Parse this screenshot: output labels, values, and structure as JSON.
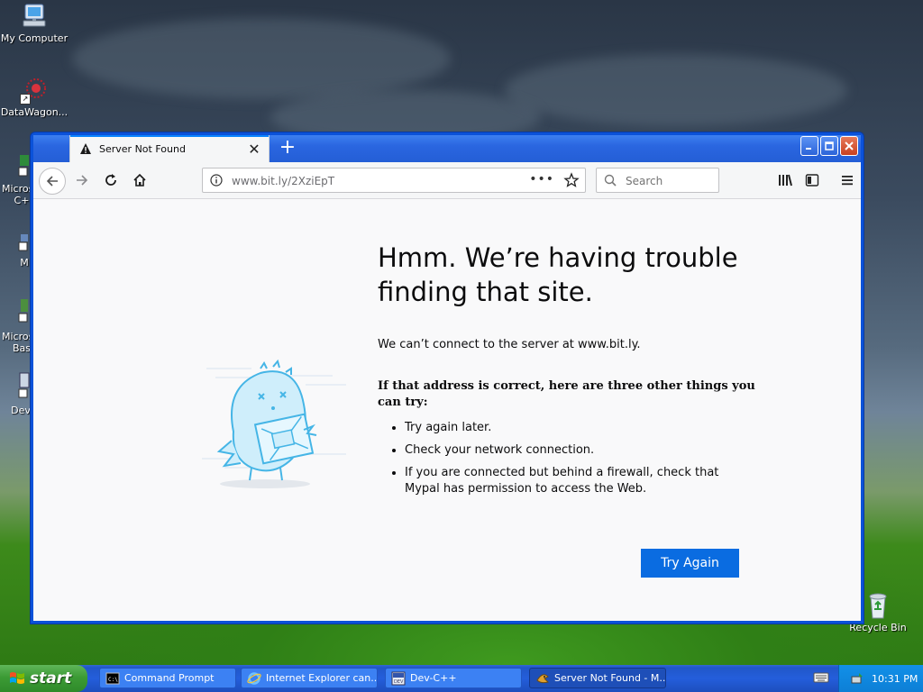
{
  "desktop": {
    "icons": [
      {
        "label": "My Computer"
      },
      {
        "label": "DataWagon..."
      },
      {
        "label": "Recycle Bin"
      }
    ],
    "partial_labels": [
      "Micros",
      "C+",
      "M",
      "Micros",
      "Bas",
      "Dev"
    ]
  },
  "browser": {
    "tab_title": "Server Not Found",
    "url": "www.bit.ly/2XziEpT",
    "search_placeholder": "Search",
    "page_actions_label": "•••"
  },
  "error_page": {
    "title": "Hmm. We’re having trouble finding that site.",
    "description": "We can’t connect to the server at www.bit.ly.",
    "subtitle": "If that address is correct, here are three other things you can try:",
    "suggestions": [
      "Try again later.",
      "Check your network connection.",
      "If you are connected but behind a firewall, check that Mypal has permission to access the Web."
    ],
    "button_label": "Try Again"
  },
  "taskbar": {
    "start_label": "start",
    "tasks": [
      {
        "label": "Command Prompt",
        "icon": "cmd-icon"
      },
      {
        "label": "Internet Explorer can...",
        "icon": "ie-icon"
      },
      {
        "label": "Dev-C++",
        "icon": "devcpp-icon"
      },
      {
        "label": "Server Not Found - M...",
        "icon": "mypal-icon",
        "active": true
      }
    ],
    "clock": "10:31 PM"
  },
  "colors": {
    "accent": "#0a84ff",
    "try_again_button": "#0a6ce1",
    "xp_titlebar": "#245ed6",
    "start_green": "#3c9b35"
  }
}
